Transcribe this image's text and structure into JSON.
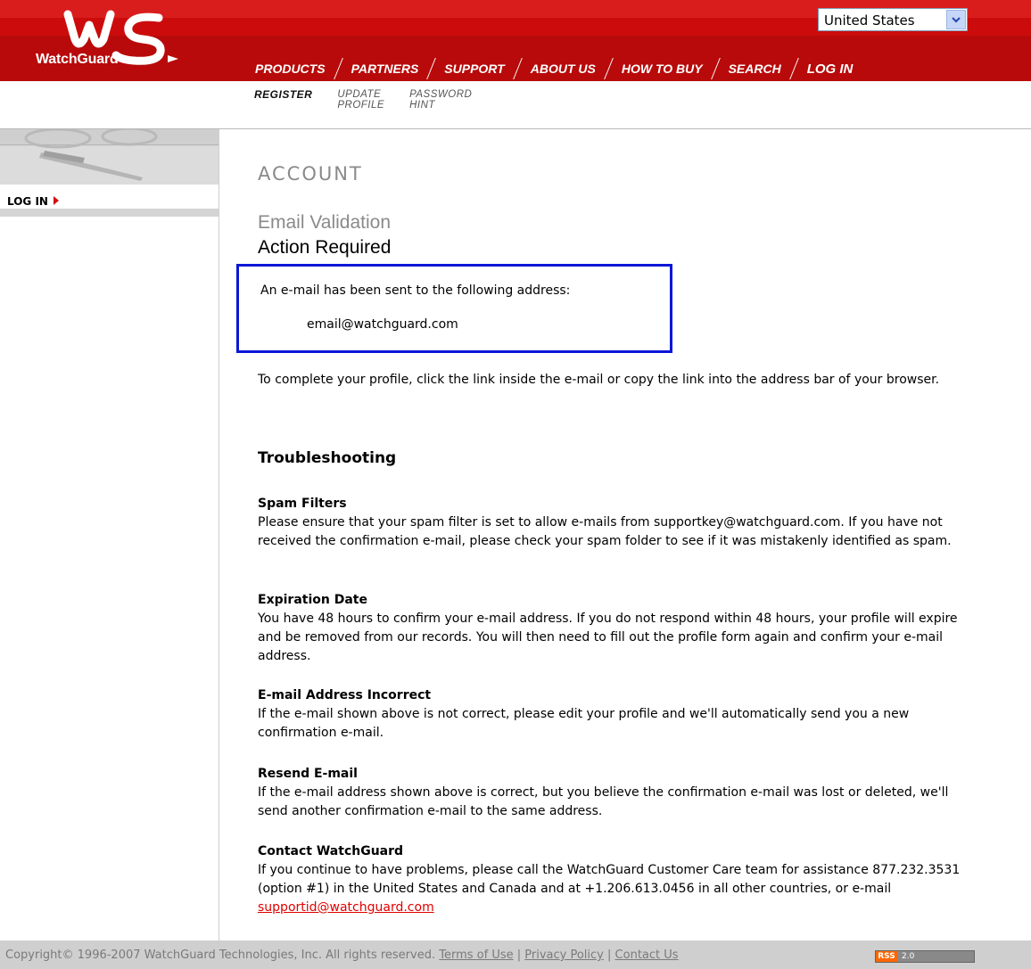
{
  "brand": {
    "logo_text": "WatchGuard",
    "primary_red": "#cc0c0c",
    "box_blue": "#0a17d6",
    "link_red": "#e00000"
  },
  "country_selector": {
    "selected": "United States",
    "icon": "chevron-down-icon"
  },
  "main_nav": [
    "PRODUCTS",
    "PARTNERS",
    "SUPPORT",
    "ABOUT US",
    "HOW TO BUY",
    "SEARCH",
    "LOG IN"
  ],
  "sub_nav": {
    "register": "REGISTER",
    "update_profile": [
      "UPDATE",
      "PROFILE"
    ],
    "password_hint": [
      "PASSWORD",
      "HINT"
    ]
  },
  "sidebar": {
    "login_label": "LOG IN",
    "login_icon": "arrow-right-icon"
  },
  "page": {
    "title": "ACCOUNT",
    "subtitle": "Email Validation",
    "heading": "Action Required"
  },
  "notice": {
    "text": "An e-mail has been sent to the following address:",
    "email": "email@watchguard.com"
  },
  "instructions": "To complete your profile, click the link inside the e-mail or copy the link into the address bar of your browser.",
  "troubleshooting": {
    "title": "Troubleshooting",
    "sections": [
      {
        "head": "Spam Filters",
        "body": "Please ensure that your spam filter is set to allow e-mails from supportkey@watchguard.com. If you have not received the confirmation e-mail, please check your spam folder to see if it was mistakenly identified as spam."
      },
      {
        "head": "Expiration Date",
        "body": "You have 48 hours to confirm your e-mail address. If you do not respond within 48 hours, your profile will expire and be removed from our records. You will then need to fill out the profile form again and confirm your e-mail address."
      },
      {
        "head": "E-mail Address Incorrect",
        "body": "If the e-mail shown above is not correct, please edit your profile and we'll automatically send you a new confirmation e-mail."
      },
      {
        "head": "Resend E-mail",
        "body": "If the e-mail address shown above is correct, but you believe the confirmation e-mail was lost or deleted, we'll send another confirmation e-mail to the same address."
      },
      {
        "head": "Contact WatchGuard",
        "body": "If you continue to have problems, please call the WatchGuard Customer Care team for assistance 877.232.3531 (option #1) in the United States and Canada and at +1.206.613.0456 in all other countries, or e-mail ",
        "link": "supportid@watchguard.com"
      }
    ]
  },
  "footer": {
    "copyright": "Copyright© 1996-2007 WatchGuard Technologies, Inc. All rights reserved.",
    "links": [
      "Terms of Use",
      "Privacy Policy",
      "Contact Us"
    ],
    "separator": " | ",
    "rss_left": "RSS",
    "rss_right": "2.0"
  }
}
